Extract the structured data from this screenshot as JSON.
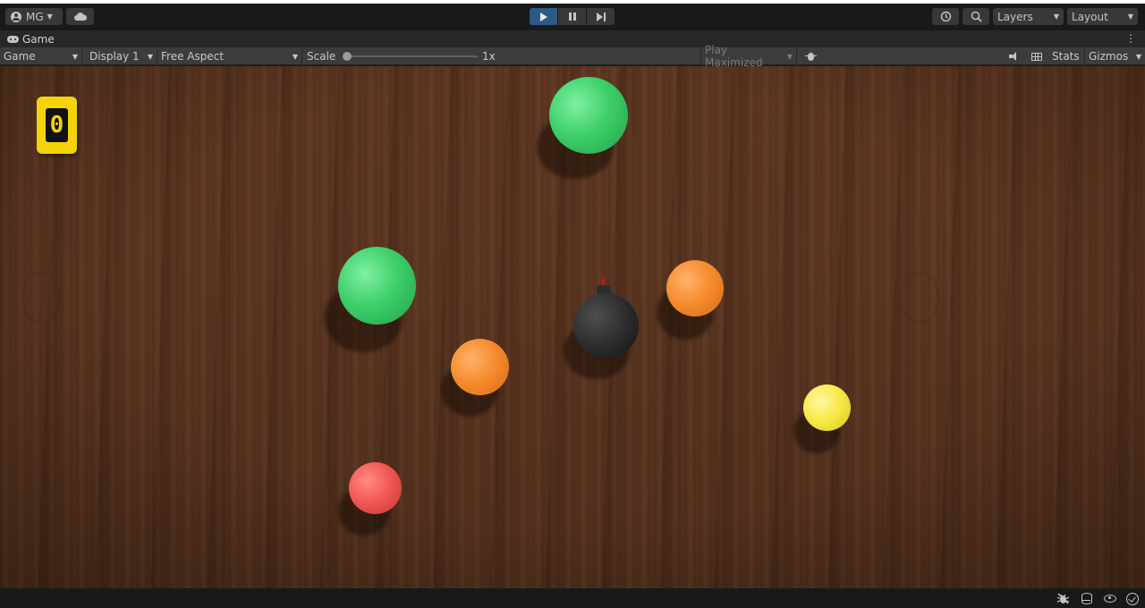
{
  "toolbar": {
    "account_label": "MG",
    "layers_label": "Layers",
    "layout_label": "Layout",
    "icons": [
      "account-icon",
      "cloud-icon",
      "play-icon",
      "pause-icon",
      "step-icon",
      "history-icon",
      "search-icon"
    ]
  },
  "tab": {
    "label": "Game"
  },
  "game_toolbar": {
    "view_mode": "Game",
    "display": "Display 1",
    "aspect": "Free Aspect",
    "scale_label": "Scale",
    "scale_value": "1x",
    "play_mode": "Play Maximized",
    "stats_label": "Stats",
    "gizmos_label": "Gizmos"
  },
  "game": {
    "score": "0",
    "objects": [
      {
        "kind": "ball",
        "color": "green"
      },
      {
        "kind": "ball",
        "color": "green"
      },
      {
        "kind": "ball",
        "color": "orange"
      },
      {
        "kind": "ball",
        "color": "orange"
      },
      {
        "kind": "ball",
        "color": "yellow"
      },
      {
        "kind": "ball",
        "color": "red"
      },
      {
        "kind": "bomb",
        "color": "black"
      }
    ],
    "colors": {
      "board": "#5a3520",
      "score_badge": "#f4d30a",
      "green": "#3ecf6a",
      "orange": "#f5892b",
      "yellow": "#f7e842",
      "red": "#f15550",
      "bomb": "#2a2a2a"
    }
  },
  "colors": {
    "accent_play": "#2b5a86",
    "toolbar_bg": "#191919",
    "panel_bg": "#3c3c3c"
  }
}
